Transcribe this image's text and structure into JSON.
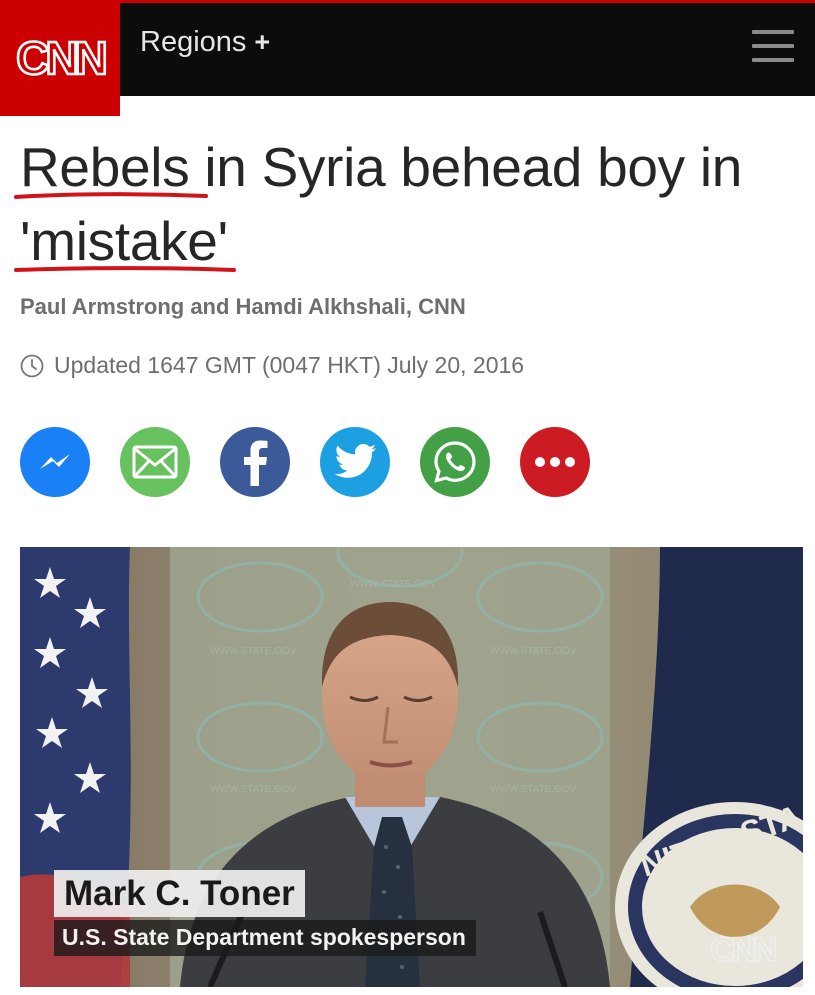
{
  "header": {
    "logo_text": "CNN",
    "regions_label": "Regions",
    "regions_plus": "+",
    "menu_icon": "hamburger-menu-icon"
  },
  "article": {
    "headline_part1": "Rebels",
    "headline_part2": " in Syria behead boy in ",
    "headline_part3": "'mistake'",
    "byline": "Paul Armstrong and Hamdi Alkhshali, CNN",
    "updated": "Updated 1647 GMT (0047 HKT) July 20, 2016"
  },
  "share": [
    {
      "name": "messenger",
      "icon": "messenger-icon",
      "color": "#1a80f6"
    },
    {
      "name": "email",
      "icon": "email-icon",
      "color": "#67c15f"
    },
    {
      "name": "facebook",
      "icon": "facebook-icon",
      "color": "#3b5a9a"
    },
    {
      "name": "twitter",
      "icon": "twitter-icon",
      "color": "#1da0e1"
    },
    {
      "name": "whatsapp",
      "icon": "whatsapp-icon",
      "color": "#43a047"
    },
    {
      "name": "more",
      "icon": "more-icon",
      "color": "#cc1b22"
    }
  ],
  "photo": {
    "caption_name": "Mark C. Toner",
    "caption_title": "U.S. State Department spokesperson",
    "seal_text": "NITED STA",
    "wall_text": "WWW.STATE.GOV",
    "watermark": "CNN"
  },
  "colors": {
    "brand_red": "#cc0000",
    "topbar": "#0c0c0c",
    "underline_red": "#d0141b"
  }
}
